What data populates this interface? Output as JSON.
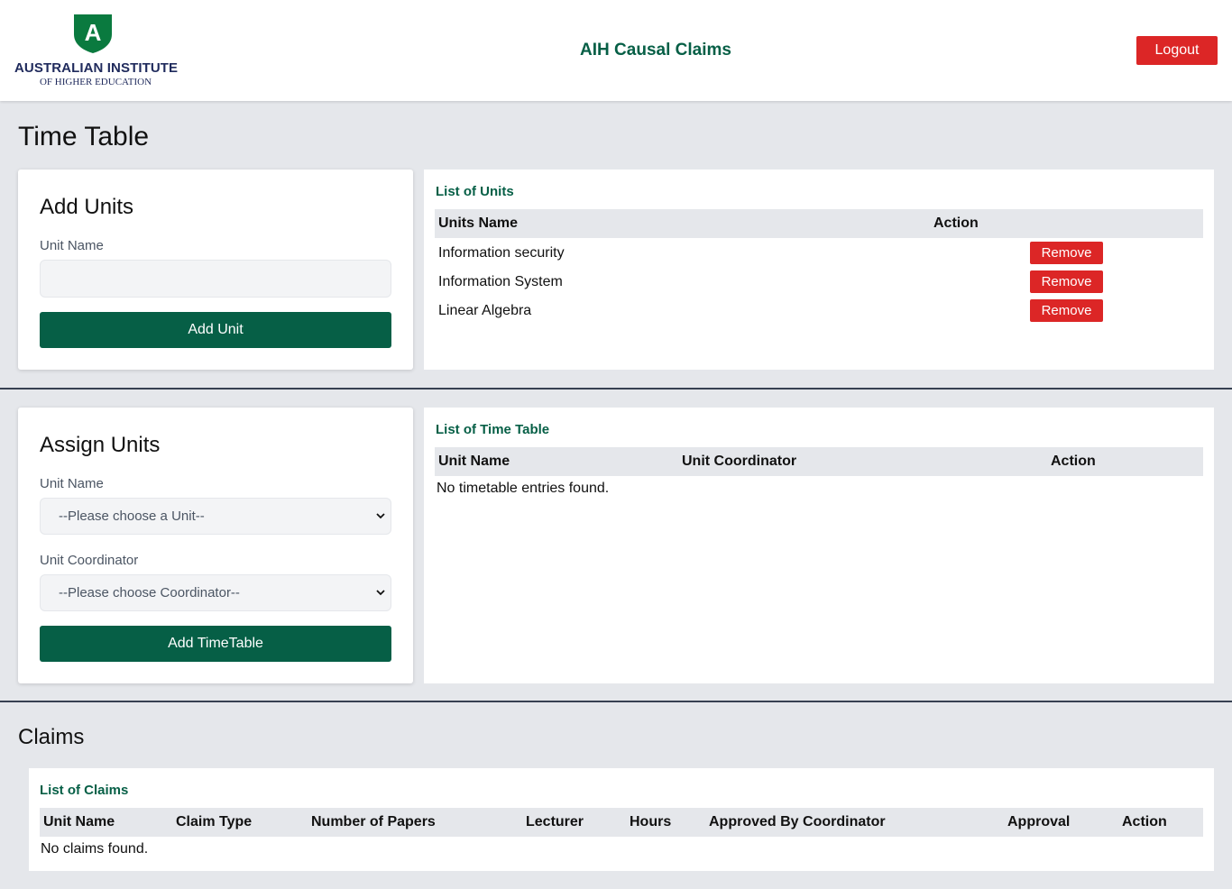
{
  "header": {
    "logo_line1": "AUSTRALIAN INSTITUTE",
    "logo_line2": "OF HIGHER EDUCATION",
    "logo_letter": "A",
    "app_title": "AIH Causal Claims",
    "logout_label": "Logout"
  },
  "page_title": "Time Table",
  "add_units": {
    "title": "Add Units",
    "unit_name_label": "Unit Name",
    "unit_name_value": "",
    "button_label": "Add Unit"
  },
  "list_of_units": {
    "title": "List of Units",
    "columns": [
      "Units Name",
      "Action"
    ],
    "rows": [
      {
        "name": "Information security",
        "action": "Remove"
      },
      {
        "name": "Information System",
        "action": "Remove"
      },
      {
        "name": "Linear Algebra",
        "action": "Remove"
      }
    ]
  },
  "assign_units": {
    "title": "Assign Units",
    "unit_name_label": "Unit Name",
    "unit_select_value": "--Please choose a Unit--",
    "coordinator_label": "Unit Coordinator",
    "coordinator_select_value": "--Please choose Coordinator--",
    "button_label": "Add TimeTable"
  },
  "list_of_timetable": {
    "title": "List of Time Table",
    "columns": [
      "Unit Name",
      "Unit Coordinator",
      "Action"
    ],
    "empty_message": "No timetable entries found."
  },
  "claims": {
    "section_title": "Claims",
    "list_title": "List of Claims",
    "columns": [
      "Unit Name",
      "Claim Type",
      "Number of Papers",
      "Lecturer",
      "Hours",
      "Approved By Coordinator",
      "Approval",
      "Action"
    ],
    "empty_message": "No claims found."
  },
  "colors": {
    "brand_green": "#065f46",
    "danger_red": "#dc2626",
    "logo_navy": "#1f2a5c",
    "page_bg": "#e5e7eb"
  },
  "icons": {
    "logo": "shield-logo-icon",
    "select_chevron": "chevron-down-icon"
  }
}
